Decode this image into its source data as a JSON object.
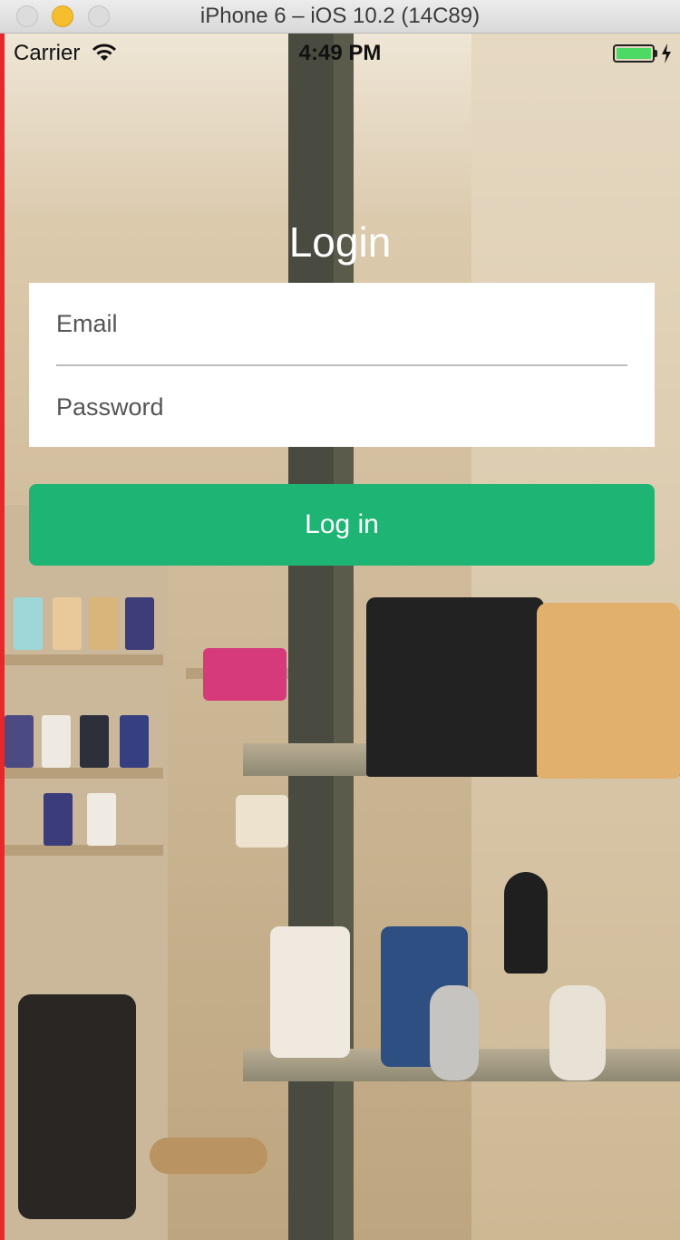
{
  "window": {
    "title": "iPhone 6 – iOS 10.2 (14C89)"
  },
  "status_bar": {
    "carrier": "Carrier",
    "time": "4:49 PM",
    "wifi_icon": "wifi-icon",
    "battery_icon": "battery-icon",
    "charging_icon": "bolt-icon",
    "battery_color": "#4cd964"
  },
  "login": {
    "title": "Login",
    "email_placeholder": "Email",
    "password_placeholder": "Password",
    "button_label": "Log in",
    "button_color": "#1eb574"
  }
}
